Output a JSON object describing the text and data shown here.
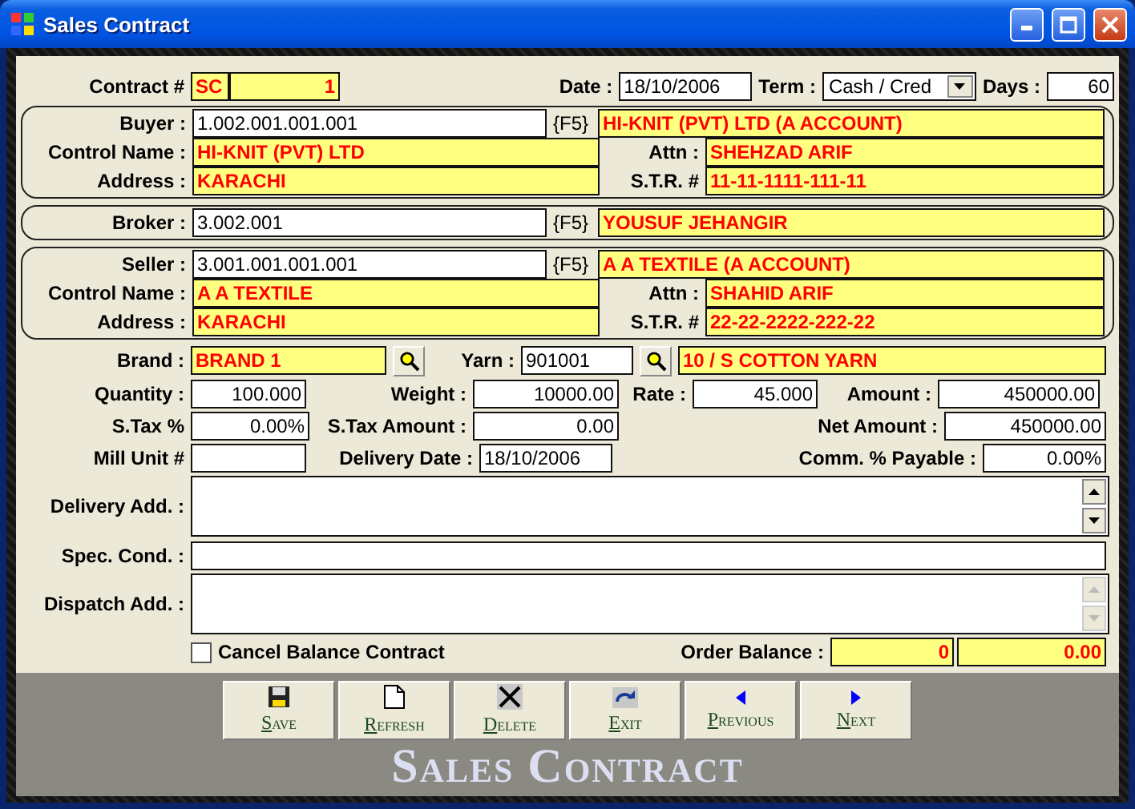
{
  "window": {
    "title": "Sales Contract"
  },
  "contract": {
    "label": "Contract #",
    "prefix": "SC",
    "number": "1"
  },
  "date": {
    "label": "Date :",
    "value": "18/10/2006"
  },
  "term": {
    "label": "Term :",
    "value": "Cash / Cred"
  },
  "days": {
    "label": "Days :",
    "value": "60"
  },
  "parties": [
    {
      "kind": "full",
      "code_label": "Buyer :",
      "code": "1.002.001.001.001",
      "hint": "{F5}",
      "name": "HI-KNIT (PVT) LTD (A ACCOUNT)",
      "control_label": "Control Name :",
      "control_name": "HI-KNIT (PVT) LTD",
      "attn_label": "Attn :",
      "attn": "SHEHZAD ARIF",
      "address_label": "Address :",
      "address": "KARACHI",
      "str_label": "S.T.R. #",
      "str": "11-11-1111-111-11"
    },
    {
      "kind": "short",
      "code_label": "Broker :",
      "code": "3.002.001",
      "hint": "{F5}",
      "name": "YOUSUF JEHANGIR"
    },
    {
      "kind": "full",
      "code_label": "Seller :",
      "code": "3.001.001.001.001",
      "hint": "{F5}",
      "name": "A A TEXTILE (A ACCOUNT)",
      "control_label": "Control Name :",
      "control_name": "A A TEXTILE",
      "attn_label": "Attn :",
      "attn": "SHAHID ARIF",
      "address_label": "Address :",
      "address": "KARACHI",
      "str_label": "S.T.R. #",
      "str": "22-22-2222-222-22"
    }
  ],
  "brand": {
    "label": "Brand :",
    "value": "BRAND 1"
  },
  "yarn": {
    "label": "Yarn :",
    "code": "901001",
    "name": "10 / S COTTON YARN"
  },
  "quantity": {
    "label": "Quantity :",
    "value": "100.000"
  },
  "weight": {
    "label": "Weight :",
    "value": "10000.00"
  },
  "rate": {
    "label": "Rate :",
    "value": "45.000"
  },
  "amount": {
    "label": "Amount :",
    "value": "450000.00"
  },
  "stax_percent": {
    "label": "S.Tax %",
    "value": "0.00%"
  },
  "stax_amount": {
    "label": "S.Tax Amount :",
    "value": "0.00"
  },
  "net_amount": {
    "label": "Net Amount :",
    "value": "450000.00"
  },
  "mill_unit": {
    "label": "Mill Unit #"
  },
  "delivery_date": {
    "label": "Delivery Date :",
    "value": "18/10/2006"
  },
  "commission": {
    "label": "Comm. % Payable :",
    "value": "0.00%"
  },
  "memos": [
    {
      "kind": "area",
      "label": "Delivery Add. :",
      "scroll_disabled": false
    },
    {
      "kind": "line",
      "label": "Spec. Cond. :"
    },
    {
      "kind": "area",
      "label": "Dispatch Add. :",
      "scroll_disabled": true
    }
  ],
  "cancel_balance": {
    "label": "Cancel Balance Contract",
    "checked": false
  },
  "order_balance": {
    "label": "Order Balance :",
    "quantity": "0",
    "value": "0.00"
  },
  "buttons": [
    {
      "kind": "save",
      "label": "Save"
    },
    {
      "kind": "refresh",
      "label": "Refresh"
    },
    {
      "kind": "delete",
      "label": "Delete"
    },
    {
      "kind": "exit",
      "label": "Exit"
    },
    {
      "kind": "previous",
      "label": "Previous"
    },
    {
      "kind": "next",
      "label": "Next"
    }
  ],
  "banner": "Sales Contract"
}
